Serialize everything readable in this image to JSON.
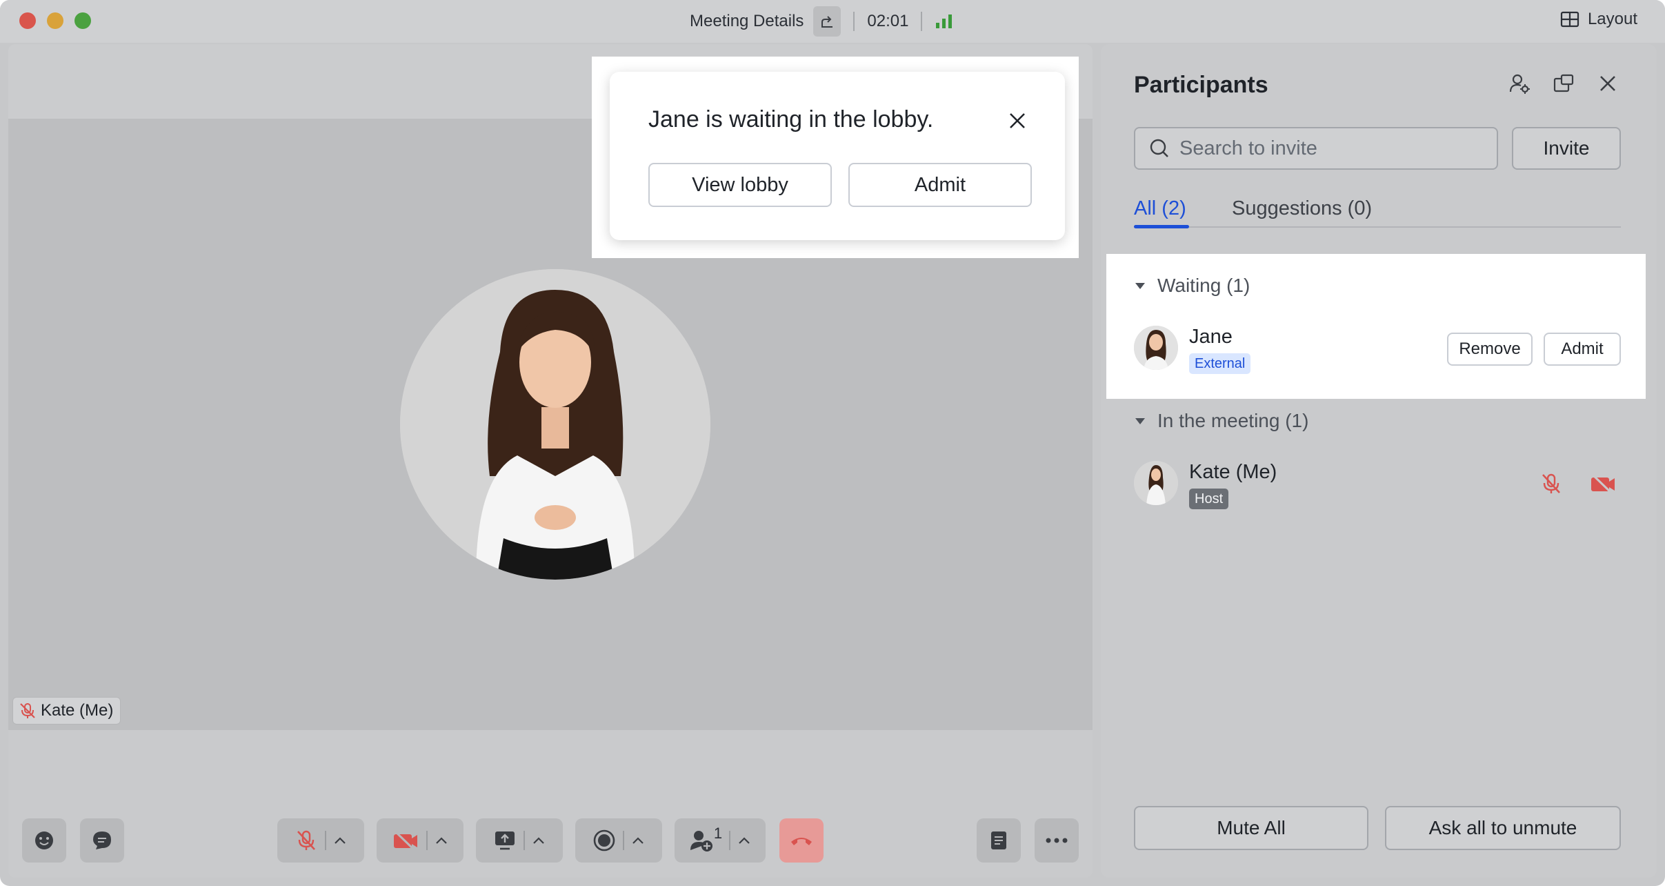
{
  "titlebar": {
    "title": "Meeting Details",
    "timer": "02:01",
    "layout_label": "Layout"
  },
  "stage": {
    "name_tag": "Kate (Me)"
  },
  "toolbar": {
    "participants_count": "1"
  },
  "popup": {
    "message": "Jane is waiting in the lobby.",
    "view_lobby": "View lobby",
    "admit": "Admit"
  },
  "panel": {
    "title": "Participants",
    "search_placeholder": "Search to invite",
    "invite": "Invite",
    "tabs": [
      {
        "label": "All (2)"
      },
      {
        "label": "Suggestions (0)"
      }
    ],
    "waiting": {
      "header": "Waiting (1)",
      "name": "Jane",
      "badge": "External",
      "remove": "Remove",
      "admit": "Admit"
    },
    "in_meeting": {
      "header": "In the meeting (1)",
      "name": "Kate (Me)",
      "badge": "Host"
    },
    "mute_all": "Mute All",
    "ask_unmute": "Ask all to unmute"
  },
  "colors": {
    "accent": "#1d4fd7",
    "danger": "#d9534f",
    "signal": "#3a9a3a"
  }
}
